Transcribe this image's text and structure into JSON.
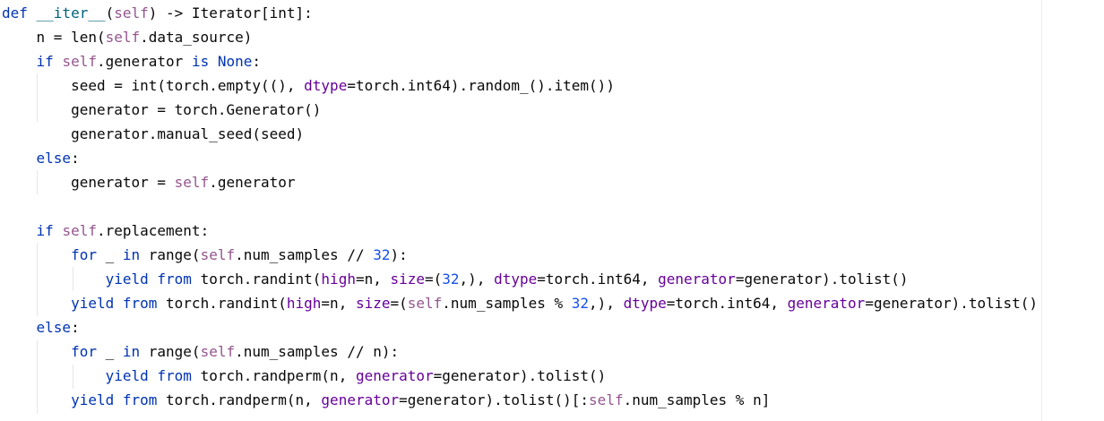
{
  "editor": {
    "lines": [
      [
        {
          "t": "def ",
          "c": "kw"
        },
        {
          "t": "__iter__",
          "c": "fn"
        },
        {
          "t": "("
        },
        {
          "t": "self",
          "c": "slf"
        },
        {
          "t": ") -> Iterator[int]:"
        }
      ],
      [
        {
          "t": "    n = len("
        },
        {
          "t": "self",
          "c": "slf"
        },
        {
          "t": ".data_source)"
        }
      ],
      [
        {
          "t": "    "
        },
        {
          "t": "if ",
          "c": "kw"
        },
        {
          "t": "self",
          "c": "slf"
        },
        {
          "t": ".generator "
        },
        {
          "t": "is None",
          "c": "kw"
        },
        {
          "t": ":"
        }
      ],
      [
        {
          "t": "        seed = int(torch.empty((), "
        },
        {
          "t": "dtype",
          "c": "prm"
        },
        {
          "t": "=torch.int64).random_().item())"
        }
      ],
      [
        {
          "t": "        generator = torch.Generator()"
        }
      ],
      [
        {
          "t": "        generator.manual_seed(seed)"
        }
      ],
      [
        {
          "t": "    "
        },
        {
          "t": "else",
          "c": "kw"
        },
        {
          "t": ":"
        }
      ],
      [
        {
          "t": "        generator = "
        },
        {
          "t": "self",
          "c": "slf"
        },
        {
          "t": ".generator"
        }
      ],
      [],
      [
        {
          "t": "    "
        },
        {
          "t": "if ",
          "c": "kw"
        },
        {
          "t": "self",
          "c": "slf"
        },
        {
          "t": ".replacement:"
        }
      ],
      [
        {
          "t": "        "
        },
        {
          "t": "for ",
          "c": "kw"
        },
        {
          "t": "_ "
        },
        {
          "t": "in ",
          "c": "kw"
        },
        {
          "t": "range("
        },
        {
          "t": "self",
          "c": "slf"
        },
        {
          "t": ".num_samples // "
        },
        {
          "t": "32",
          "c": "num"
        },
        {
          "t": "):"
        }
      ],
      [
        {
          "t": "            "
        },
        {
          "t": "yield from ",
          "c": "kw"
        },
        {
          "t": "torch.randint("
        },
        {
          "t": "high",
          "c": "prm"
        },
        {
          "t": "=n, "
        },
        {
          "t": "size",
          "c": "prm"
        },
        {
          "t": "=("
        },
        {
          "t": "32",
          "c": "num"
        },
        {
          "t": ",), "
        },
        {
          "t": "dtype",
          "c": "prm"
        },
        {
          "t": "=torch.int64, "
        },
        {
          "t": "generator",
          "c": "prm"
        },
        {
          "t": "=generator).tolist()"
        }
      ],
      [
        {
          "t": "        "
        },
        {
          "t": "yield from ",
          "c": "kw"
        },
        {
          "t": "torch.randint("
        },
        {
          "t": "high",
          "c": "prm"
        },
        {
          "t": "=n, "
        },
        {
          "t": "size",
          "c": "prm"
        },
        {
          "t": "=("
        },
        {
          "t": "self",
          "c": "slf"
        },
        {
          "t": ".num_samples % "
        },
        {
          "t": "32",
          "c": "num"
        },
        {
          "t": ",), "
        },
        {
          "t": "dtype",
          "c": "prm"
        },
        {
          "t": "=torch.int64, "
        },
        {
          "t": "generator",
          "c": "prm"
        },
        {
          "t": "=generator).tolist()"
        }
      ],
      [
        {
          "t": "    "
        },
        {
          "t": "else",
          "c": "kw"
        },
        {
          "t": ":"
        }
      ],
      [
        {
          "t": "        "
        },
        {
          "t": "for ",
          "c": "kw"
        },
        {
          "t": "_ "
        },
        {
          "t": "in ",
          "c": "kw"
        },
        {
          "t": "range("
        },
        {
          "t": "self",
          "c": "slf"
        },
        {
          "t": ".num_samples // n):"
        }
      ],
      [
        {
          "t": "            "
        },
        {
          "t": "yield from ",
          "c": "kw"
        },
        {
          "t": "torch.randperm(n, "
        },
        {
          "t": "generator",
          "c": "prm"
        },
        {
          "t": "=generator).tolist()"
        }
      ],
      [
        {
          "t": "        "
        },
        {
          "t": "yield from ",
          "c": "kw"
        },
        {
          "t": "torch.randperm(n, "
        },
        {
          "t": "generator",
          "c": "prm"
        },
        {
          "t": "=generator).tolist()[:"
        },
        {
          "t": "self",
          "c": "slf"
        },
        {
          "t": ".num_samples % n]"
        }
      ]
    ]
  }
}
